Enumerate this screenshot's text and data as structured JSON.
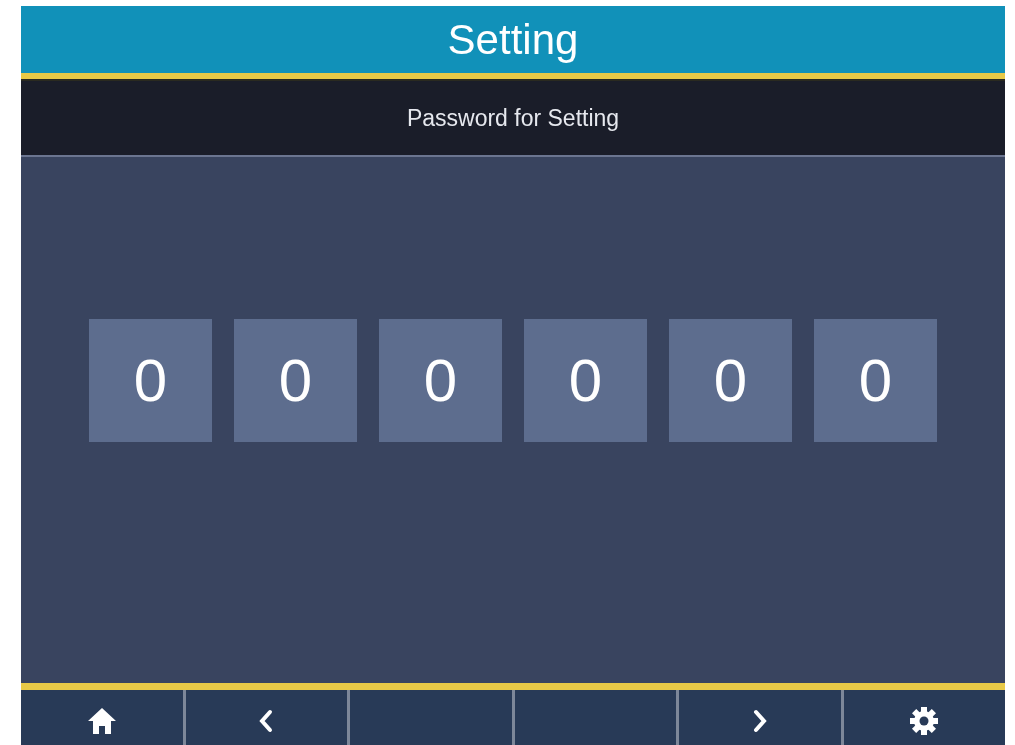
{
  "header": {
    "title": "Setting"
  },
  "subheader": {
    "title": "Password for Setting"
  },
  "password_digits": [
    "0",
    "0",
    "0",
    "0",
    "0",
    "0"
  ],
  "footer_buttons": [
    {
      "kind": "home"
    },
    {
      "kind": "prev"
    },
    {
      "kind": "blank"
    },
    {
      "kind": "blank"
    },
    {
      "kind": "next"
    },
    {
      "kind": "settings"
    }
  ]
}
